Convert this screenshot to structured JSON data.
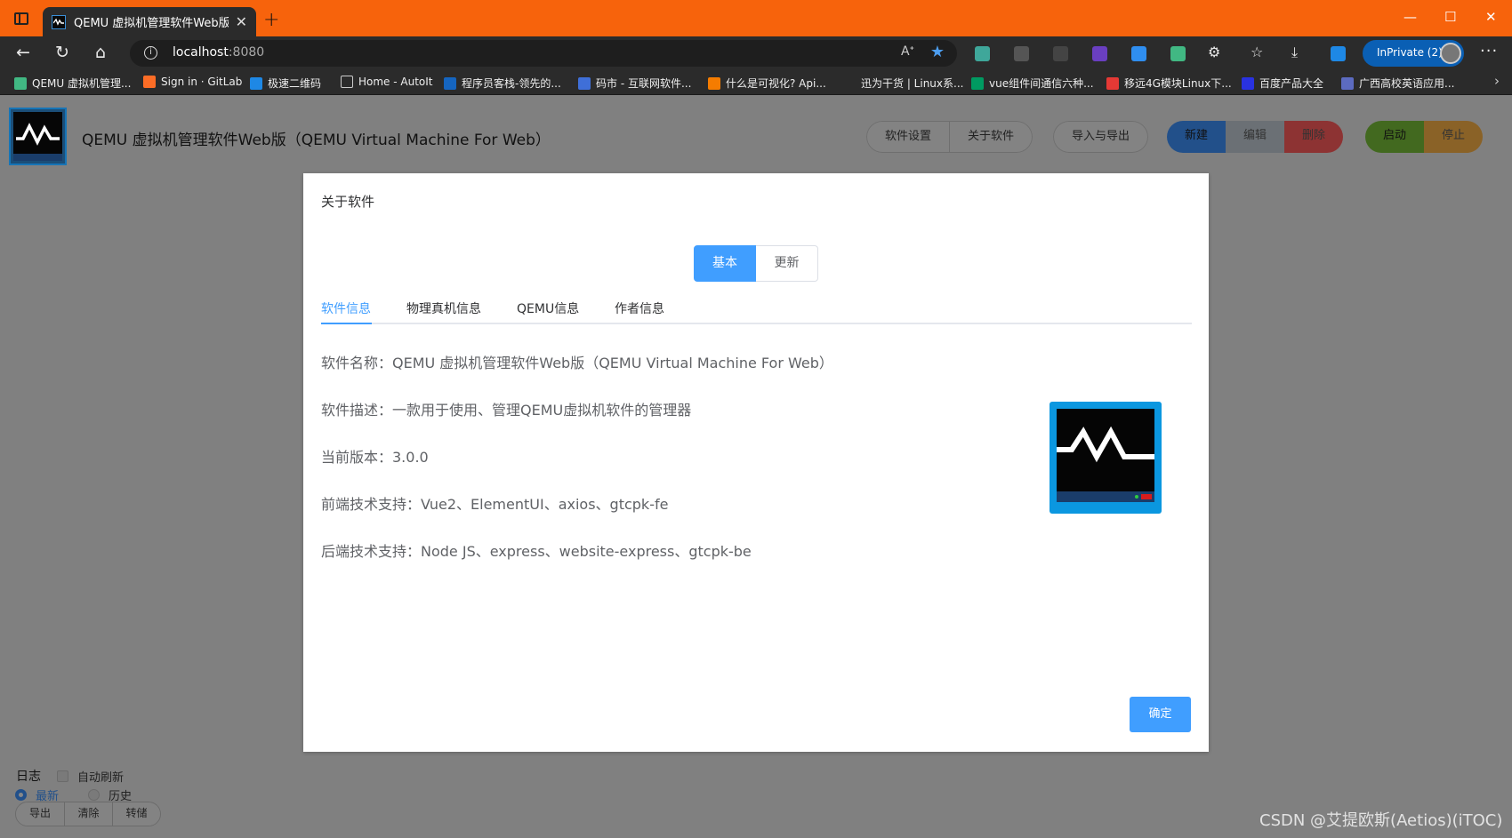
{
  "browser": {
    "tab_title": "QEMU 虚拟机管理软件Web版（(",
    "url_host": "localhost",
    "url_port": ":8080",
    "inprivate_label": "InPrivate (2)",
    "bookmarks": [
      "QEMU 虚拟机管理...",
      "Sign in · GitLab",
      "极速二维码",
      "Home - AutoIt",
      "程序员客栈-领先的...",
      "码市 - 互联网软件...",
      "什么是可视化? Api...",
      "迅为干货 | Linux系...",
      "vue组件间通信六种...",
      "移远4G模块Linux下...",
      "百度产品大全",
      "广西高校英语应用..."
    ],
    "colors": {
      "titlebar": "#f7630c",
      "chrome": "#2b2b2b"
    }
  },
  "app": {
    "title": "QEMU 虚拟机管理软件Web版（QEMU Virtual Machine For Web）",
    "header_buttons": {
      "settings": "软件设置",
      "about": "关于软件",
      "import_export": "导入与导出",
      "new": "新建",
      "edit": "编辑",
      "delete": "删除",
      "start": "启动",
      "stop": "停止"
    },
    "log": {
      "label": "日志",
      "auto_refresh": "自动刷新",
      "latest": "最新",
      "history": "历史",
      "export": "导出",
      "clear": "清除",
      "dump": "转储"
    },
    "watermark": "CSDN @艾提欧斯(Aetios)(iTOC)"
  },
  "dialog": {
    "title": "关于软件",
    "segments": {
      "basic": "基本",
      "update": "更新"
    },
    "tabs": [
      "软件信息",
      "物理真机信息",
      "QEMU信息",
      "作者信息"
    ],
    "info": {
      "name": "软件名称：QEMU 虚拟机管理软件Web版（QEMU Virtual Machine For Web）",
      "desc": "软件描述：一款用于使用、管理QEMU虚拟机软件的管理器",
      "version": "当前版本：3.0.0",
      "frontend": "前端技术支持：Vue2、ElementUI、axios、gtcpk-fe",
      "backend": "后端技术支持：Node JS、express、website-express、gtcpk-be"
    },
    "confirm": "确定",
    "accent": "#409eff"
  }
}
